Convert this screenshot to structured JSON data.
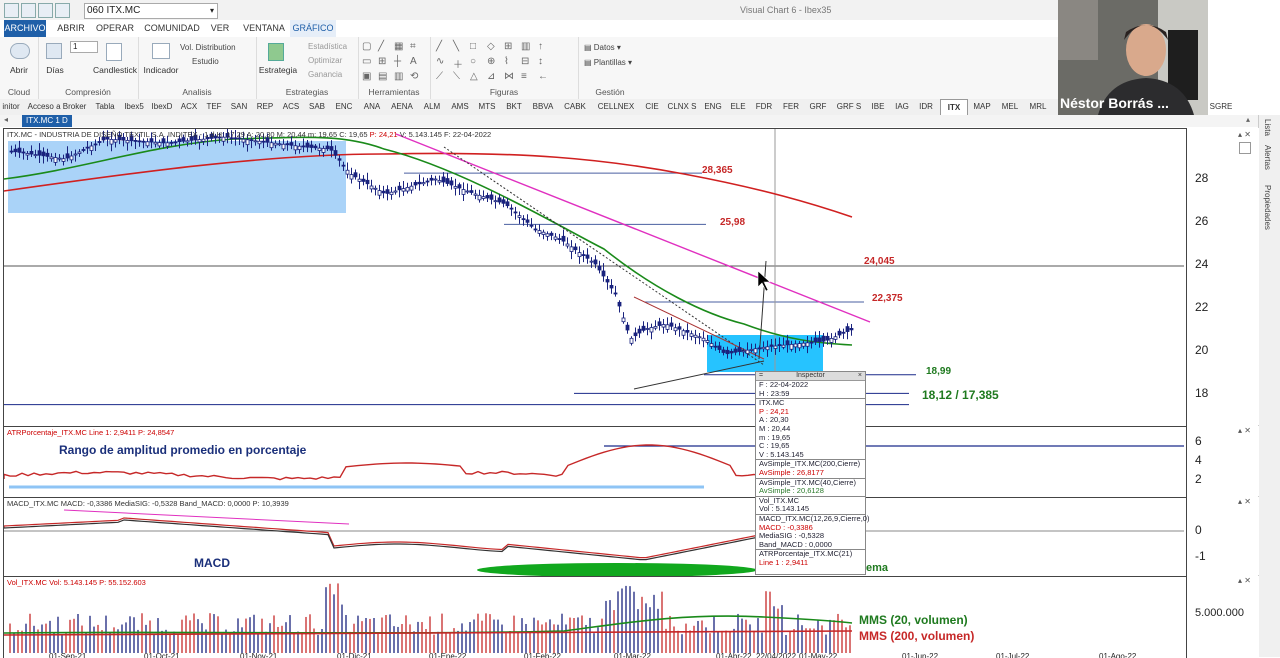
{
  "titlebar": {
    "symbol_input": "060 ITX.MC",
    "app_title": "Visual Chart 6 - Ibex35"
  },
  "menu": {
    "tabs": [
      "ARCHIVO",
      "ABRIR",
      "OPERAR",
      "COMUNIDAD",
      "VER",
      "VENTANA",
      "GRÁFICO"
    ],
    "context_label": "GRÁFICO"
  },
  "ribbon": {
    "abrir": "Abrir",
    "cloud": "Cloud",
    "dias": "Días",
    "period_value": "1",
    "candlestick": "Candlestick",
    "compresion": "Compresión",
    "indicador": "Indicador",
    "vol_distribution": "Vol. Distribution",
    "estudio": "Estudio",
    "analisis": "Analisis",
    "estrategia": "Estrategia",
    "estadistica": "Estadística",
    "optimizar": "Optimizar",
    "ganancia": "Ganancia",
    "estrategias": "Estrategias",
    "herramientas": "Herramientas",
    "figuras": "Figuras",
    "datos": "Datos",
    "plantillas": "Plantillas",
    "gestion": "Gestión"
  },
  "symbols": [
    "initor",
    "Acceso a Broker",
    "Tabla",
    "Ibex5",
    "IbexD",
    "ACX",
    "TEF",
    "SAN",
    "REP",
    "ACS",
    "SAB",
    "ENC",
    "ANA",
    "AENA",
    "ALM",
    "AMS",
    "MTS",
    "BKT",
    "BBVA",
    "CABK",
    "CELLNEX",
    "CIE",
    "CLNX S",
    "ENG",
    "ELE",
    "FDR",
    "FER",
    "GRF",
    "GRF S",
    "IBE",
    "IAG",
    "IDR",
    "ITX",
    "MAP",
    "MEL",
    "MRL",
    "NTGY",
    "COL",
    "PHM",
    "REE",
    "ROVI",
    "SGRE"
  ],
  "chart_tab": "ITX.MC 1 D",
  "webcam": {
    "name": "Néstor Borrás ..."
  },
  "side_panel": {
    "items": [
      "Lista",
      "Alertas",
      "Propiedades"
    ]
  },
  "price_pane": {
    "info_prefix": "ITX.MC - INDUSTRIA DE DISEÑO TEXTIL S.A. INDITEX - 1 d H: 17:29 A: 20,30 M: 20,44 m: 19,65 C: 19,65",
    "info_p": "P: 24,21",
    "info_suffix": "V: 5.143.145 F: 22-04-2022",
    "y_ticks": [
      "28",
      "26",
      "24",
      "22",
      "20",
      "18"
    ],
    "levels": {
      "l1": "28,365",
      "l2": "25,98",
      "l3": "24,045",
      "l4": "22,375",
      "l5": "18,99",
      "l6": "18,12 / 17,385"
    }
  },
  "atr_pane": {
    "info": "ATRPorcentaje_ITX.MC Line 1: 2,9411 P: 24,8547",
    "title": "Rango de amplitud promedio en porcentaje",
    "y_ticks": [
      "6",
      "4",
      "2"
    ]
  },
  "macd_pane": {
    "info": "MACD_ITX.MC MACD: -0,3386 MediaSIG: -0,5328 Band_MACD: 0,0000 P: 10,3939",
    "title": "MACD",
    "y_ticks": [
      "0",
      "-1"
    ],
    "extra": "ema"
  },
  "vol_pane": {
    "info": "Vol_ITX.MC Vol: 5.143.145 P: 55.152.603",
    "y_tick": "5.000.000",
    "mms20": "MMS (20, volumen)",
    "mms200": "MMS (200, volumen)"
  },
  "x_axis": [
    "01-Sep-21",
    "01-Oct-21",
    "01-Nov-21",
    "01-Dic-21",
    "01-Ene-22",
    "01-Feb-22",
    "01-Mar-22",
    "01-Abr-22",
    "22/04/2022",
    "01-May-22",
    "01-Jun-22",
    "01-Jul-22",
    "01-Ago-22"
  ],
  "inspector": {
    "title": "Inspector",
    "rows": [
      {
        "t": "F : 22-04-2022",
        "c": ""
      },
      {
        "t": "H : 23:59",
        "c": ""
      },
      {
        "t": "ITX.MC",
        "c": "sep"
      },
      {
        "t": "P : 24,21",
        "c": "red"
      },
      {
        "t": "A : 20,30",
        "c": ""
      },
      {
        "t": "M : 20,44",
        "c": ""
      },
      {
        "t": "m : 19,65",
        "c": ""
      },
      {
        "t": "C : 19,65",
        "c": ""
      },
      {
        "t": "V : 5.143.145",
        "c": ""
      },
      {
        "t": "AvSimple_ITX.MC(200,Cierre)",
        "c": "sep"
      },
      {
        "t": "AvSimple : 26,8177",
        "c": "red"
      },
      {
        "t": "AvSimple_ITX.MC(40,Cierre)",
        "c": "sep"
      },
      {
        "t": "AvSimple : 20,6128",
        "c": "grn"
      },
      {
        "t": "Vol_ITX.MC",
        "c": "sep"
      },
      {
        "t": "Vol : 5.143.145",
        "c": ""
      },
      {
        "t": "MACD_ITX.MC(12,26,9,Cierre,0)",
        "c": "sep"
      },
      {
        "t": "MACD : -0,3386",
        "c": "red"
      },
      {
        "t": "MediaSIG : -0,5328",
        "c": ""
      },
      {
        "t": "Band_MACD : 0,0000",
        "c": ""
      },
      {
        "t": "ATRPorcentaje_ITX.MC(21)",
        "c": "sep"
      },
      {
        "t": "Line 1 : 2,9411",
        "c": "red"
      }
    ]
  },
  "colors": {
    "accent": "#1f5fa8",
    "ma200": "#d02020",
    "ma40": "#1a8a1a",
    "trend": "#e030c0",
    "level_red": "#c62828",
    "level_green": "#1f7a1f",
    "highlight": "#00b8ff"
  }
}
